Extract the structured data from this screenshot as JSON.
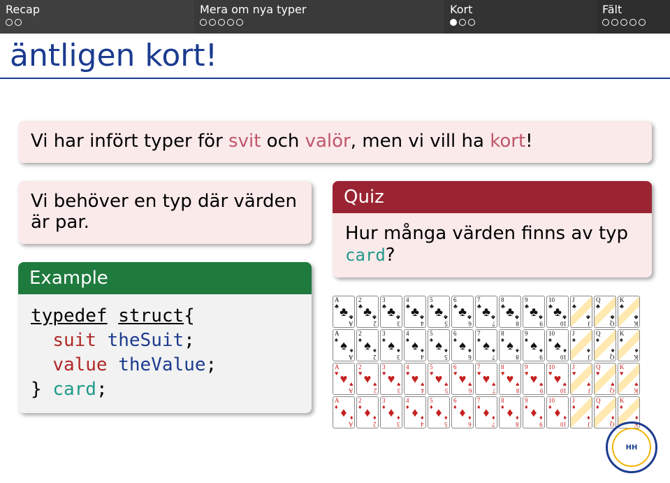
{
  "nav": {
    "recap": {
      "title": "Recap",
      "total": 2,
      "current": -1
    },
    "mera": {
      "title": "Mera om nya typer",
      "total": 5,
      "current": -1
    },
    "kort": {
      "title": "Kort",
      "total": 3,
      "current": 0
    },
    "falt": {
      "title": "Fält",
      "total": 5,
      "current": -1
    }
  },
  "frametitle": "äntligen kort!",
  "intro": {
    "pre": "Vi har infört typer för ",
    "w1": "svit",
    "mid": " och ",
    "w2": "valör",
    "post": ", men vi vill ha ",
    "w3": "kort",
    "end": "!"
  },
  "left": {
    "need": "Vi behöver en typ där värden är par.",
    "example_title": "Example",
    "code": {
      "l1a": "typedef",
      "l1b": "struct",
      "l1c": "{",
      "l2a": "suit",
      "l2b": "theSuit",
      "l2c": ";",
      "l3a": "value",
      "l3b": "theValue",
      "l3c": ";",
      "l4a": "} ",
      "l4b": "card",
      "l4c": ";"
    }
  },
  "right": {
    "quiz_title": "Quiz",
    "quiz_text_a": "Hur många värden finns av typ",
    "quiz_text_b": "card",
    "quiz_text_c": "?"
  },
  "suits": [
    {
      "sym": "♣",
      "color": "blk"
    },
    {
      "sym": "♠",
      "color": "blk"
    },
    {
      "sym": "♥",
      "color": "red"
    },
    {
      "sym": "♦",
      "color": "red"
    }
  ],
  "ranks": [
    "A",
    "2",
    "3",
    "4",
    "5",
    "6",
    "7",
    "8",
    "9",
    "10",
    "J",
    "Q",
    "K"
  ],
  "logo": "HÖGSKOLAN HALMSTAD"
}
